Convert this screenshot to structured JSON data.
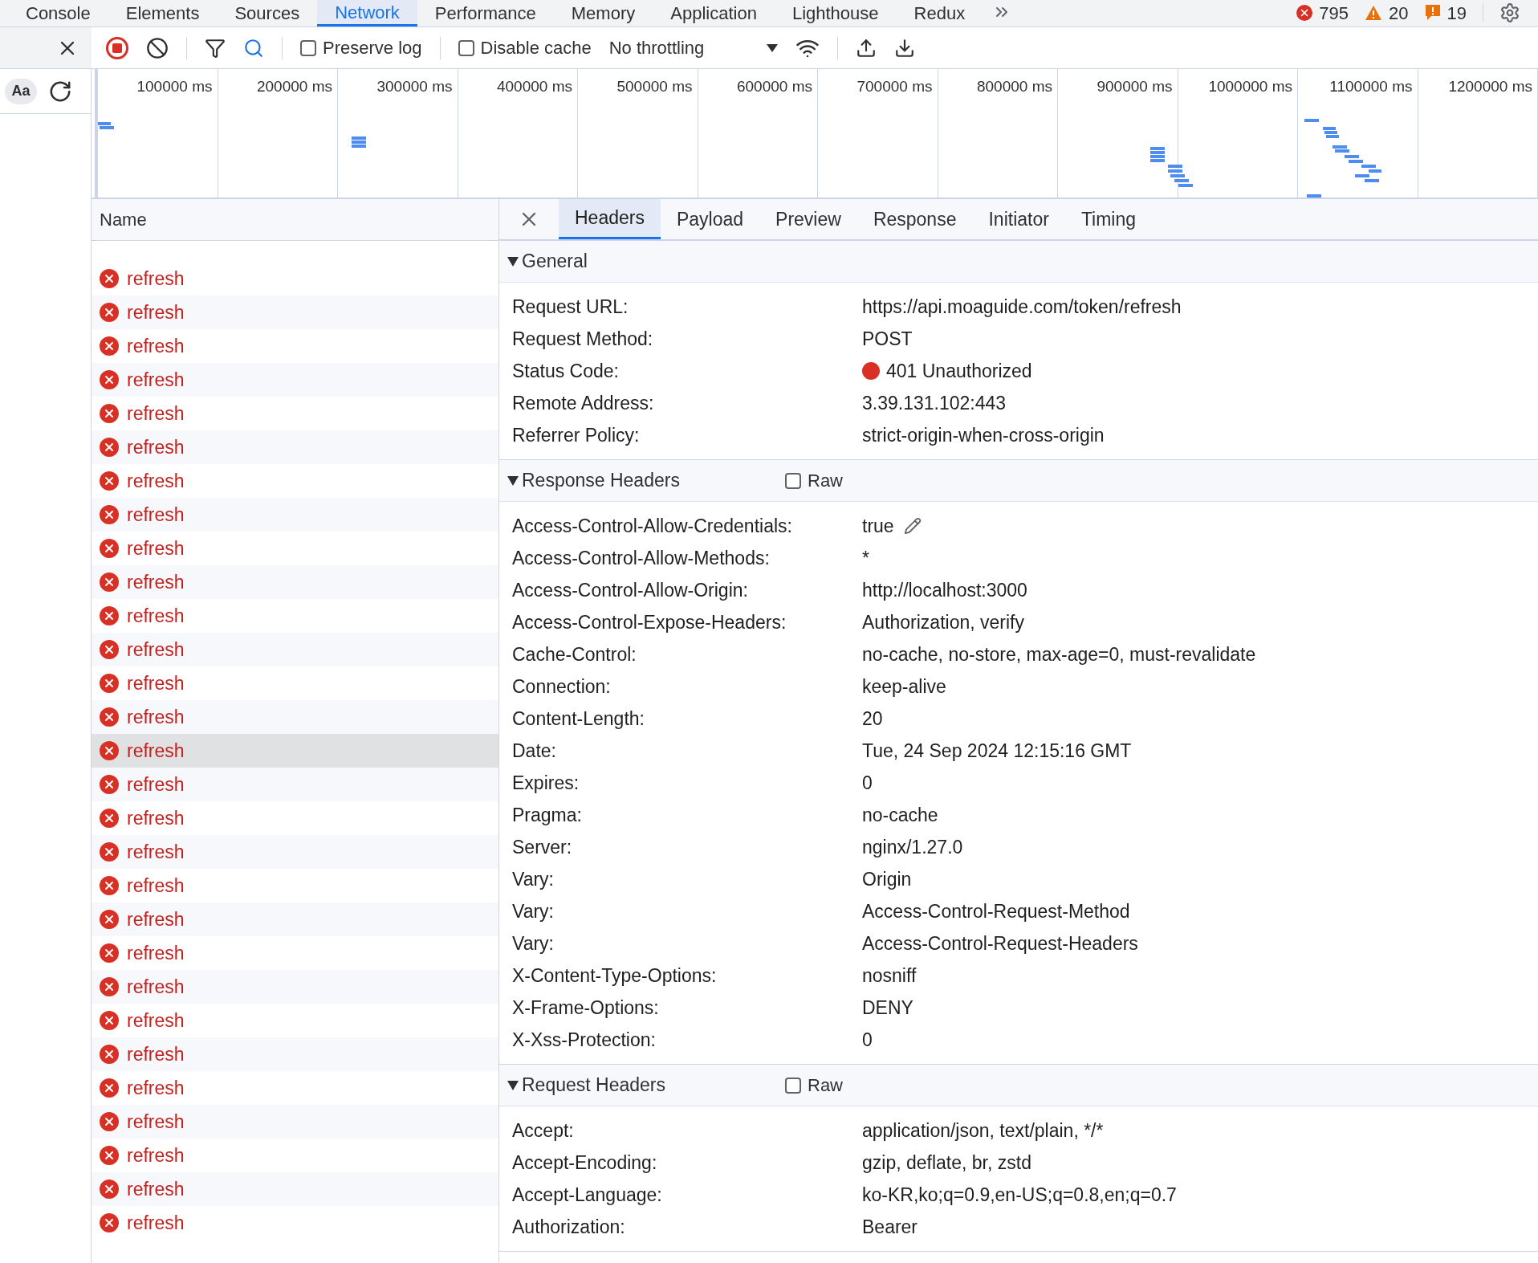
{
  "panel_tabs": [
    {
      "label": "Console",
      "selected": false
    },
    {
      "label": "Elements",
      "selected": false
    },
    {
      "label": "Sources",
      "selected": false
    },
    {
      "label": "Network",
      "selected": true
    },
    {
      "label": "Performance",
      "selected": false
    },
    {
      "label": "Memory",
      "selected": false
    },
    {
      "label": "Application",
      "selected": false
    },
    {
      "label": "Lighthouse",
      "selected": false
    },
    {
      "label": "Redux",
      "selected": false
    }
  ],
  "counters": [
    {
      "kind": "error",
      "count": "795"
    },
    {
      "kind": "warning",
      "count": "20"
    },
    {
      "kind": "issue",
      "count": "19"
    }
  ],
  "toolbar": {
    "recording": true,
    "search_active": true,
    "preserve_log": {
      "label": "Preserve log",
      "checked": false
    },
    "disable_cache": {
      "label": "Disable cache",
      "checked": false
    },
    "throttling": "No throttling"
  },
  "sidebar": {
    "case_button": "Aa"
  },
  "timeline": {
    "ticks": [
      "100000 ms",
      "200000 ms",
      "300000 ms",
      "400000 ms",
      "500000 ms",
      "600000 ms",
      "700000 ms",
      "800000 ms",
      "900000 ms",
      "1000000 ms",
      "1100000 ms",
      "1200000 ms"
    ]
  },
  "requests": {
    "column": "Name",
    "rows": [
      {
        "name": "refresh",
        "failed": true,
        "selected": false
      },
      {
        "name": "refresh",
        "failed": true,
        "selected": false
      },
      {
        "name": "refresh",
        "failed": true,
        "selected": false
      },
      {
        "name": "refresh",
        "failed": true,
        "selected": false
      },
      {
        "name": "refresh",
        "failed": true,
        "selected": false
      },
      {
        "name": "refresh",
        "failed": true,
        "selected": false
      },
      {
        "name": "refresh",
        "failed": true,
        "selected": false
      },
      {
        "name": "refresh",
        "failed": true,
        "selected": false
      },
      {
        "name": "refresh",
        "failed": true,
        "selected": false
      },
      {
        "name": "refresh",
        "failed": true,
        "selected": false
      },
      {
        "name": "refresh",
        "failed": true,
        "selected": false
      },
      {
        "name": "refresh",
        "failed": true,
        "selected": false
      },
      {
        "name": "refresh",
        "failed": true,
        "selected": false
      },
      {
        "name": "refresh",
        "failed": true,
        "selected": false
      },
      {
        "name": "refresh",
        "failed": true,
        "selected": true
      },
      {
        "name": "refresh",
        "failed": true,
        "selected": false
      },
      {
        "name": "refresh",
        "failed": true,
        "selected": false
      },
      {
        "name": "refresh",
        "failed": true,
        "selected": false
      },
      {
        "name": "refresh",
        "failed": true,
        "selected": false
      },
      {
        "name": "refresh",
        "failed": true,
        "selected": false
      },
      {
        "name": "refresh",
        "failed": true,
        "selected": false
      },
      {
        "name": "refresh",
        "failed": true,
        "selected": false
      },
      {
        "name": "refresh",
        "failed": true,
        "selected": false
      },
      {
        "name": "refresh",
        "failed": true,
        "selected": false
      },
      {
        "name": "refresh",
        "failed": true,
        "selected": false
      },
      {
        "name": "refresh",
        "failed": true,
        "selected": false
      },
      {
        "name": "refresh",
        "failed": true,
        "selected": false
      },
      {
        "name": "refresh",
        "failed": true,
        "selected": false
      },
      {
        "name": "refresh",
        "failed": true,
        "selected": false
      }
    ]
  },
  "detail_tabs": [
    {
      "label": "Headers",
      "selected": true
    },
    {
      "label": "Payload",
      "selected": false
    },
    {
      "label": "Preview",
      "selected": false
    },
    {
      "label": "Response",
      "selected": false
    },
    {
      "label": "Initiator",
      "selected": false
    },
    {
      "label": "Timing",
      "selected": false
    }
  ],
  "sections": [
    {
      "title": "General",
      "expanded": true,
      "rows": [
        {
          "name": "Request URL:",
          "value": "https://api.moaguide.com/token/refresh"
        },
        {
          "name": "Request Method:",
          "value": "POST"
        },
        {
          "name": "Status Code:",
          "value": "401 Unauthorized",
          "color": "#d93025"
        },
        {
          "name": "Remote Address:",
          "value": "3.39.131.102:443"
        },
        {
          "name": "Referrer Policy:",
          "value": "strict-origin-when-cross-origin"
        }
      ]
    },
    {
      "title": "Response Headers",
      "expanded": true,
      "raw": {
        "label": "Raw",
        "checked": false
      },
      "rows": [
        {
          "name": "Access-Control-Allow-Credentials:",
          "value": "true",
          "editable": true
        },
        {
          "name": "Access-Control-Allow-Methods:",
          "value": "*"
        },
        {
          "name": "Access-Control-Allow-Origin:",
          "value": "http://localhost:3000"
        },
        {
          "name": "Access-Control-Expose-Headers:",
          "value": "Authorization, verify"
        },
        {
          "name": "Cache-Control:",
          "value": "no-cache, no-store, max-age=0, must-revalidate"
        },
        {
          "name": "Connection:",
          "value": "keep-alive"
        },
        {
          "name": "Content-Length:",
          "value": "20"
        },
        {
          "name": "Date:",
          "value": "Tue, 24 Sep 2024 12:15:16 GMT"
        },
        {
          "name": "Expires:",
          "value": "0"
        },
        {
          "name": "Pragma:",
          "value": "no-cache"
        },
        {
          "name": "Server:",
          "value": "nginx/1.27.0"
        },
        {
          "name": "Vary:",
          "value": "Origin"
        },
        {
          "name": "Vary:",
          "value": "Access-Control-Request-Method"
        },
        {
          "name": "Vary:",
          "value": "Access-Control-Request-Headers"
        },
        {
          "name": "X-Content-Type-Options:",
          "value": "nosniff"
        },
        {
          "name": "X-Frame-Options:",
          "value": "DENY"
        },
        {
          "name": "X-Xss-Protection:",
          "value": "0"
        }
      ]
    },
    {
      "title": "Request Headers",
      "expanded": true,
      "raw": {
        "label": "Raw",
        "checked": false
      },
      "rows": [
        {
          "name": "Accept:",
          "value": "application/json, text/plain, */*"
        },
        {
          "name": "Accept-Encoding:",
          "value": "gzip, deflate, br, zstd"
        },
        {
          "name": "Accept-Language:",
          "value": "ko-KR,ko;q=0.9,en-US;q=0.8,en;q=0.7"
        },
        {
          "name": "Authorization:",
          "value": "Bearer"
        }
      ]
    }
  ]
}
